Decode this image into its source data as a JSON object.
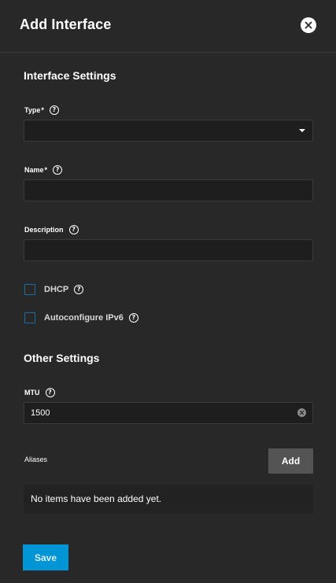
{
  "dialog": {
    "title": "Add Interface",
    "close_icon": "close-icon"
  },
  "interface_settings": {
    "heading": "Interface Settings",
    "type": {
      "label": "Type",
      "required_mark": "*",
      "value": "",
      "help_icon": "help-icon"
    },
    "name": {
      "label": "Name",
      "required_mark": "*",
      "value": "",
      "help_icon": "help-icon"
    },
    "description": {
      "label": "Description",
      "value": "",
      "help_icon": "help-icon"
    },
    "dhcp": {
      "label": "DHCP",
      "checked": false
    },
    "autoconfigure_ipv6": {
      "label": "Autoconfigure IPv6",
      "checked": false
    }
  },
  "other_settings": {
    "heading": "Other Settings",
    "mtu": {
      "label": "MTU",
      "value": "1500",
      "help_icon": "help-icon"
    },
    "aliases": {
      "label": "Aliases",
      "add_label": "Add",
      "empty_text": "No items have been added yet."
    }
  },
  "footer": {
    "save_label": "Save"
  },
  "colors": {
    "background": "#282828",
    "input_background": "#1e1e1e",
    "primary": "#0095d5",
    "checkbox_border": "#1a6fa0",
    "add_button": "#545454"
  }
}
